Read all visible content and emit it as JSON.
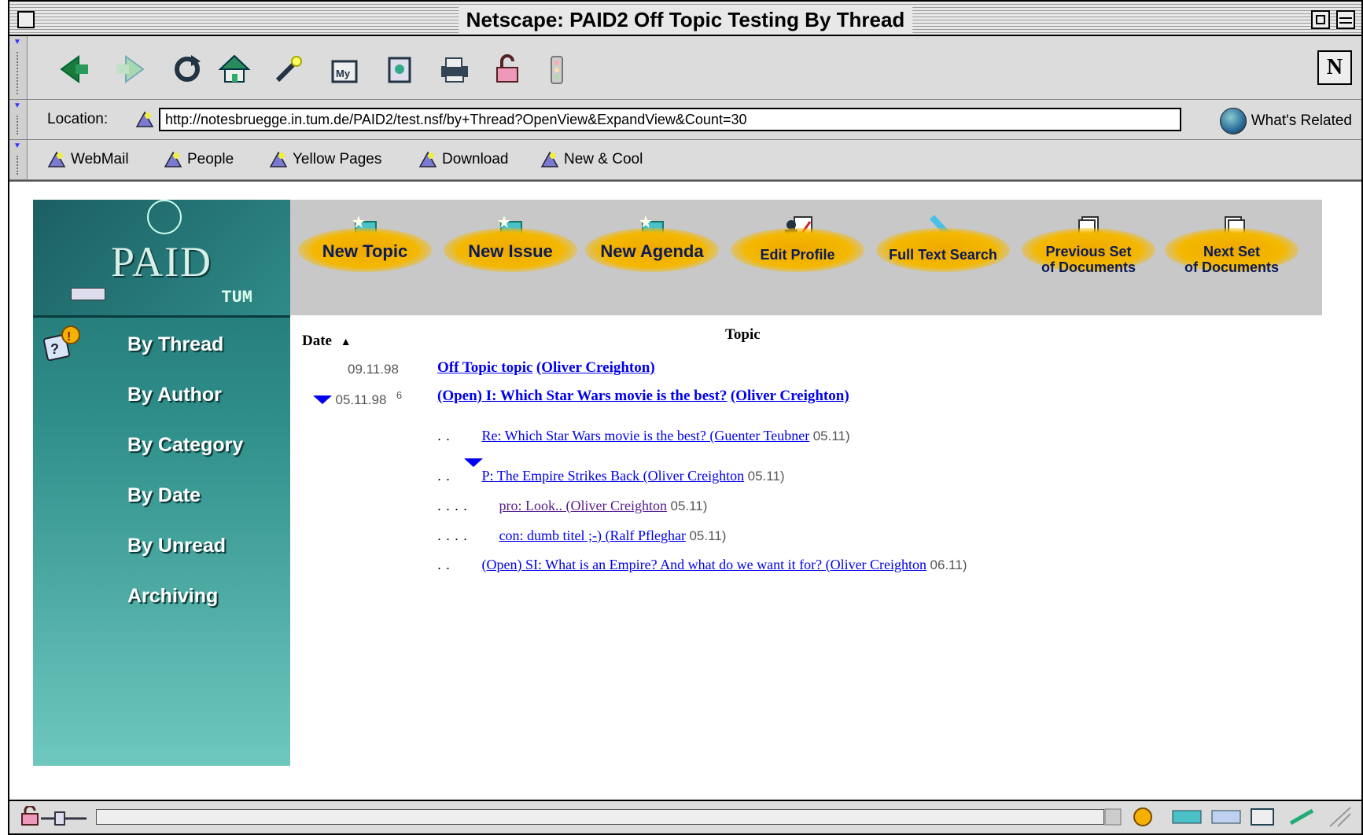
{
  "window": {
    "title": "Netscape: PAID2 Off Topic Testing By Thread"
  },
  "nav_toolbar": {
    "buttons": [
      "back-icon",
      "forward-icon",
      "reload-icon",
      "home-icon",
      "search-icon",
      "my-netscape-icon",
      "images-icon",
      "print-icon",
      "security-icon",
      "stop-icon"
    ],
    "logo": "N"
  },
  "location_bar": {
    "label": "Location:",
    "url": "http://notesbruegge.in.tum.de/PAID2/test.nsf/by+Thread?OpenView&ExpandView&Count=30",
    "related": "What's Related"
  },
  "bookmarks": {
    "items": [
      "WebMail",
      "People",
      "Yellow Pages",
      "Download",
      "New & Cool"
    ]
  },
  "header_buttons": [
    {
      "label": "New Topic"
    },
    {
      "label": "New Issue"
    },
    {
      "label": "New Agenda"
    },
    {
      "label": "Edit Profile"
    },
    {
      "label": "Full Text Search"
    },
    {
      "line1": "Previous Set",
      "line2": "of Documents"
    },
    {
      "line1": "Next Set",
      "line2": "of Documents"
    }
  ],
  "logo": {
    "text": "PAID",
    "tum": "TUM"
  },
  "sidebar": {
    "items": [
      "By Thread",
      "By Author",
      "By Category",
      "By Date",
      "By Unread",
      "Archiving"
    ]
  },
  "table": {
    "date_header": "Date",
    "topic_header": "Topic",
    "rows": [
      {
        "date": "09.11.98",
        "title": "Off Topic topic",
        "author": "(Oliver Creighton)"
      },
      {
        "date": "05.11.98",
        "count": "6",
        "title": "(Open) I: Which Star Wars movie is the best?",
        "author": "(Oliver Creighton)"
      },
      {
        "dots": "..",
        "title": "Re: Which Star Wars movie is the best? (Guenter Teubner",
        "suffix": "05.11)"
      },
      {
        "dots": "..",
        "title": "P: The Empire Strikes Back (Oliver Creighton",
        "suffix": "05.11)"
      },
      {
        "dots": "....",
        "title": "pro: Look.. (Oliver Creighton",
        "suffix": "05.11)"
      },
      {
        "dots": "....",
        "title": "con: dumb titel ;-) (Ralf Pfleghar",
        "suffix": "05.11)"
      },
      {
        "dots": "..",
        "title": "(Open) SI: What is an Empire? And what do we want it for? (Oliver Creighton",
        "suffix": "06.11)"
      }
    ]
  }
}
